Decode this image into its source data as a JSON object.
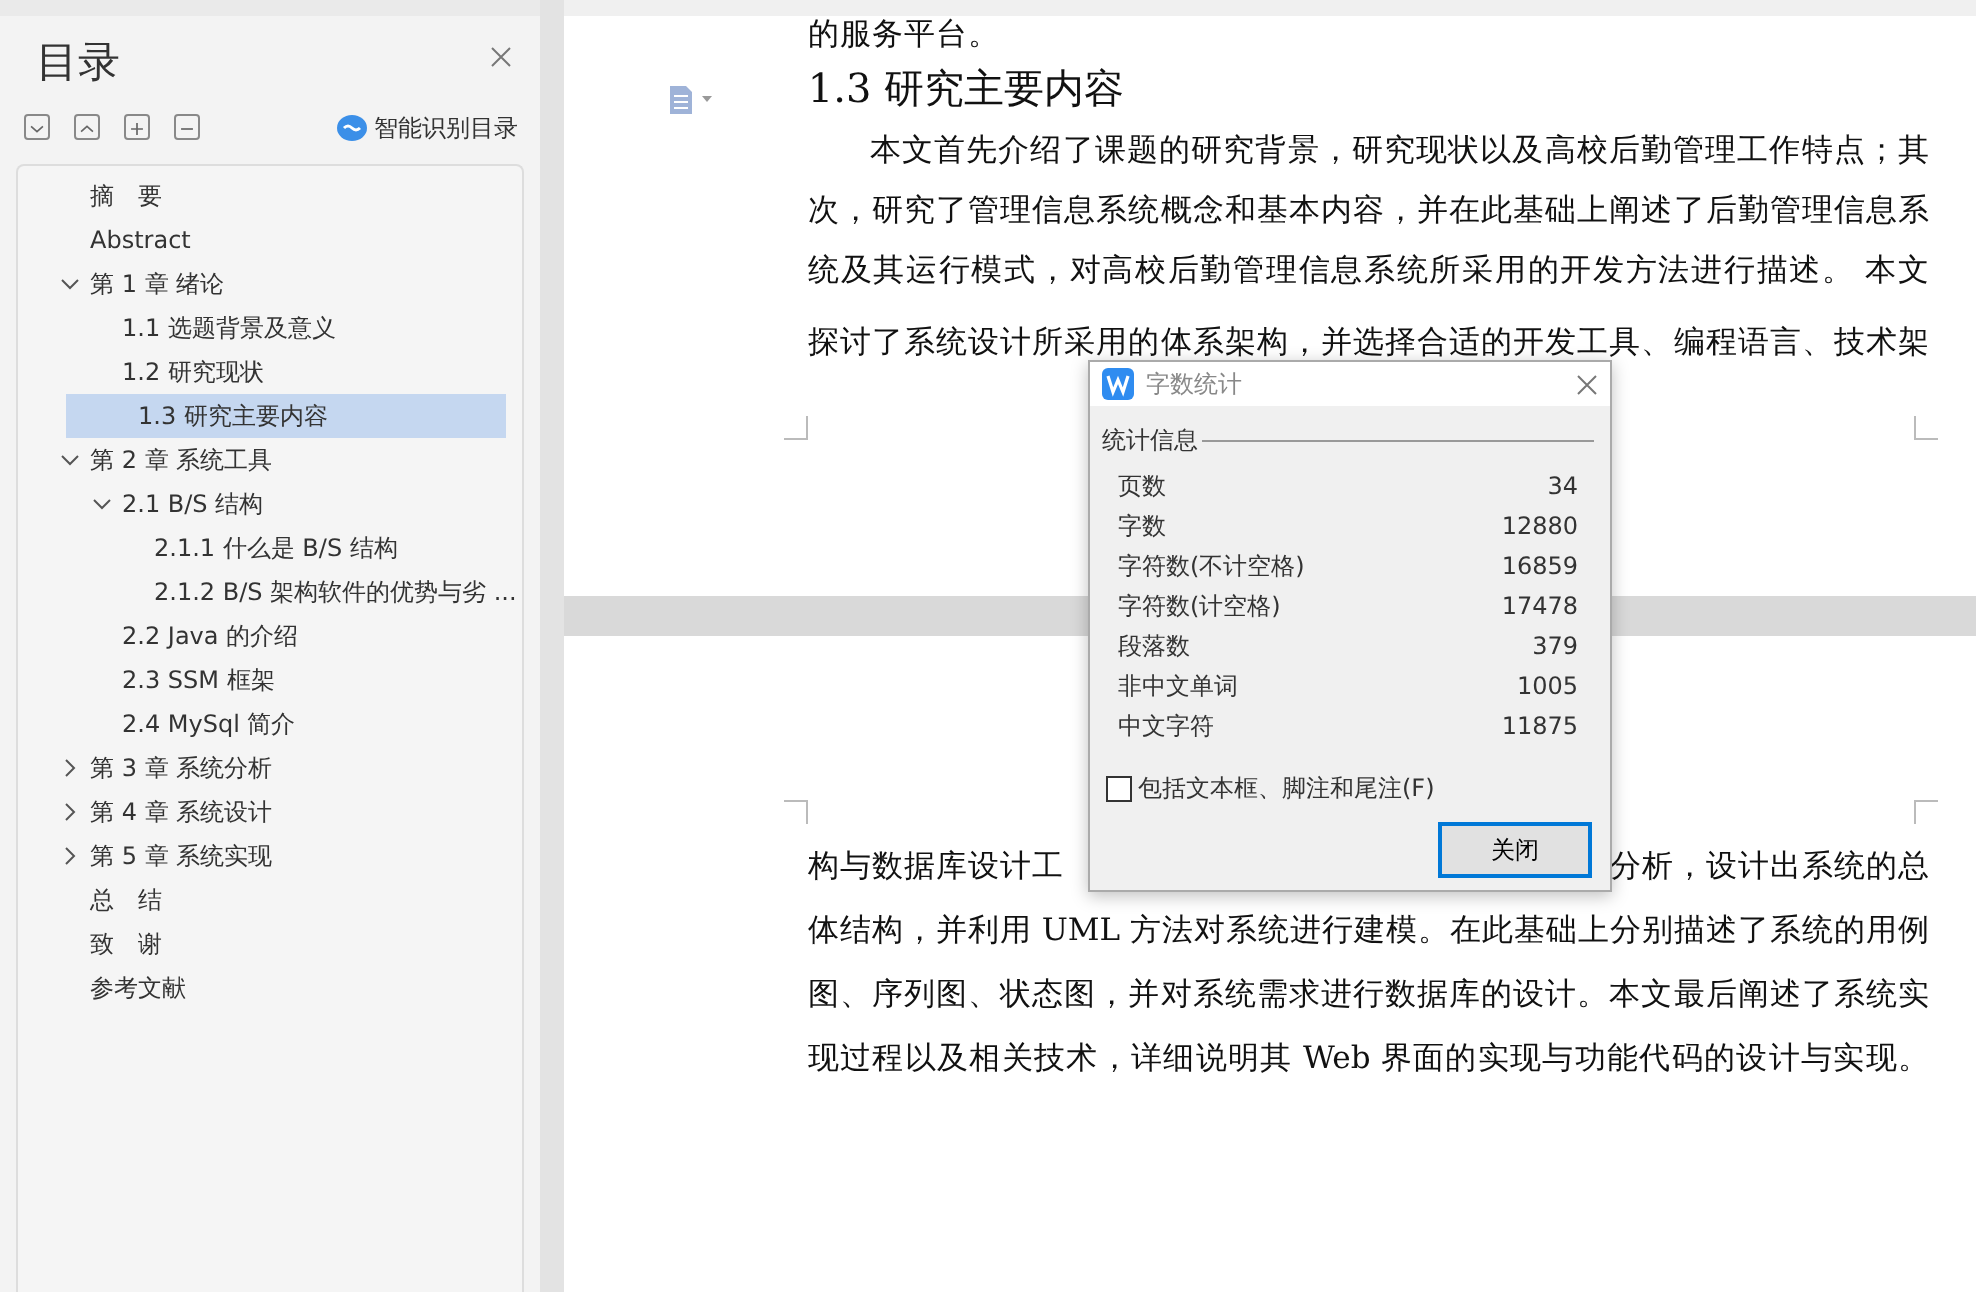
{
  "sidebar": {
    "title": "目录",
    "tools": [
      {
        "kind": "collapse"
      },
      {
        "kind": "expand"
      },
      {
        "kind": "plus"
      },
      {
        "kind": "minus"
      }
    ],
    "smart_button": "智能识别目录",
    "tree": [
      {
        "label": "摘　要",
        "selected": false
      },
      {
        "label": "Abstract",
        "selected": false
      },
      {
        "label": "第 1 章  绪论",
        "selected": false,
        "expanded": true,
        "children": [
          {
            "label": "1.1  选题背景及意义",
            "selected": false
          },
          {
            "label": "1.2 研究现状",
            "selected": false
          },
          {
            "label": "1.3 研究主要内容",
            "selected": true
          }
        ]
      },
      {
        "label": "第 2 章  系统工具",
        "selected": false,
        "expanded": true,
        "children": [
          {
            "label": "2.1 B/S 结构",
            "selected": false,
            "expanded": true,
            "children": [
              {
                "label": "2.1.1  什么是 B/S 结构",
                "selected": false
              },
              {
                "label": "2.1.2 B/S 架构软件的优势与劣 ...",
                "selected": false
              }
            ]
          },
          {
            "label": "2.2 Java 的介绍",
            "selected": false
          },
          {
            "label": "2.3 SSM 框架",
            "selected": false
          },
          {
            "label": "2.4 MySql 简介",
            "selected": false
          }
        ]
      },
      {
        "label": "第 3 章  系统分析",
        "selected": false,
        "expanded": false
      },
      {
        "label": "第 4 章  系统设计",
        "selected": false,
        "expanded": false
      },
      {
        "label": "第 5 章  系统实现",
        "selected": false,
        "expanded": false
      },
      {
        "label": "总　结",
        "selected": false
      },
      {
        "label": "致　谢",
        "selected": false
      },
      {
        "label": "参考文献",
        "selected": false
      }
    ]
  },
  "document": {
    "page1": {
      "top_line": "的服务平台。",
      "heading": "1.3 研究主要内容",
      "lines": [
        "本文首先介绍了课题的研究背景，研究现状以及高校后勤管理工作特点；其",
        "次，研究了管理信息系统概念和基本内容，并在此基础上阐述了后勤管理信息系",
        "统及其运行模式，对高校后勤管理信息系统所采用的开发方法进行描述。 本文",
        "探讨了系统设计所采用的体系架构，并选择合适的开发工具、编程语言、技术架"
      ]
    },
    "page2": {
      "split_line": {
        "left": "构与数据库设计工",
        "right": "分析，设计出系统的总"
      },
      "lines": [
        "体结构，并利用 UML 方法对系统进行建模。在此基础上分别描述了系统的用例",
        "图、序列图、状态图，并对系统需求进行数据库的设计。本文最后阐述了系统实",
        "现过程以及相关技术，详细说明其 Web 界面的实现与功能代码的设计与实现。"
      ]
    }
  },
  "dialog": {
    "title": "字数统计",
    "group": "统计信息",
    "stats": [
      {
        "label": "页数",
        "value": "34"
      },
      {
        "label": "字数",
        "value": "12880"
      },
      {
        "label": "字符数(不计空格)",
        "value": "16859"
      },
      {
        "label": "字符数(计空格)",
        "value": "17478"
      },
      {
        "label": "段落数",
        "value": "379"
      },
      {
        "label": "非中文单词",
        "value": "1005"
      },
      {
        "label": "中文字符",
        "value": "11875"
      }
    ],
    "include_checkbox": {
      "label": "包括文本框、脚注和尾注(F)",
      "checked": false
    },
    "close_button": "关闭"
  }
}
